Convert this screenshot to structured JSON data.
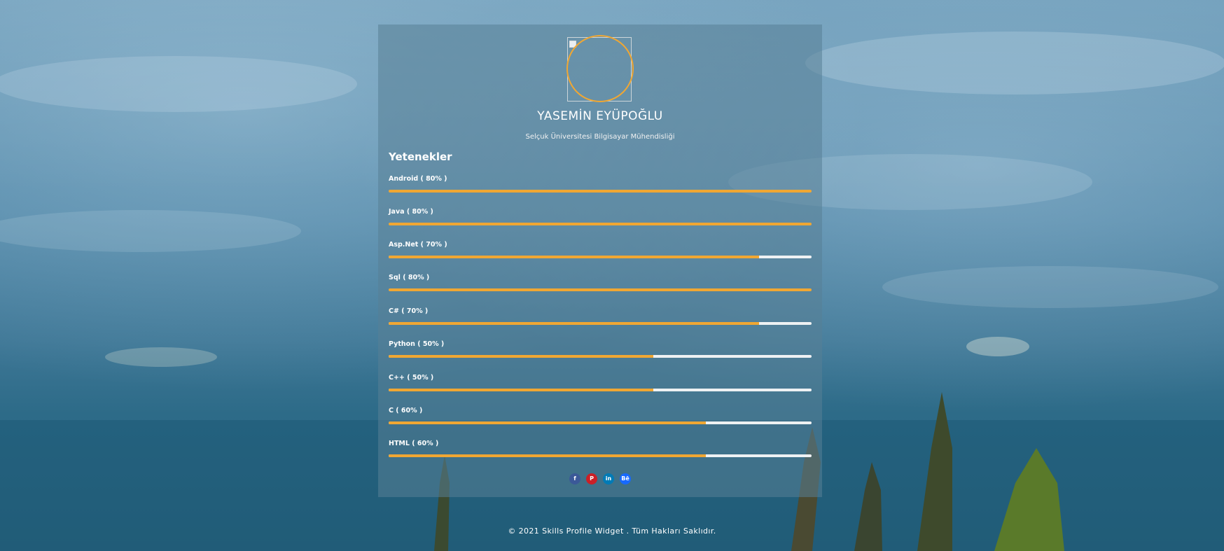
{
  "profile": {
    "name": "YASEMİN EYÜPOĞLU",
    "subtitle": "Selçuk Üniversitesi Bilgisayar Mühendisliği"
  },
  "skills": {
    "title": "Yetenekler",
    "items": [
      {
        "label": "Android ( 80% )",
        "fill": 1.0
      },
      {
        "label": "Java ( 80% )",
        "fill": 1.0
      },
      {
        "label": "Asp.Net ( 70% )",
        "fill": 0.875
      },
      {
        "label": "Sql ( 80% )",
        "fill": 1.0
      },
      {
        "label": "C# ( 70% )",
        "fill": 0.875
      },
      {
        "label": "Python ( 50% )",
        "fill": 0.625
      },
      {
        "label": "C++ ( 50% )",
        "fill": 0.625
      },
      {
        "label": "C ( 60% )",
        "fill": 0.75
      },
      {
        "label": "HTML ( 60% )",
        "fill": 0.75
      }
    ]
  },
  "social": [
    {
      "icon": "facebook-icon",
      "glyph": "f",
      "color": "#3b5998"
    },
    {
      "icon": "pinterest-icon",
      "glyph": "P",
      "color": "#cb2027"
    },
    {
      "icon": "linkedin-icon",
      "glyph": "in",
      "color": "#007bb6"
    },
    {
      "icon": "behance-icon",
      "glyph": "Bē",
      "color": "#1769ff"
    }
  ],
  "colors": {
    "accent": "#f0a733",
    "track": "#eef1f3"
  },
  "footer": {
    "text": "© 2021 Skills Profile Widget . Tüm Hakları Saklıdır."
  }
}
